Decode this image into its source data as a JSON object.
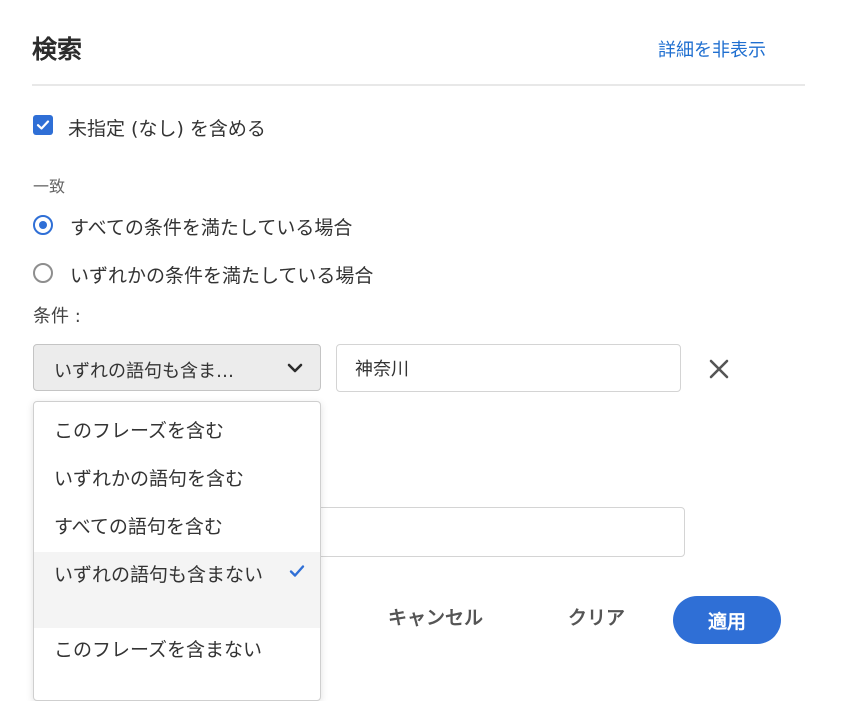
{
  "header": {
    "title": "検索",
    "toggle_details": "詳細を非表示"
  },
  "include_unspecified": {
    "label": "未指定 (なし) を含める",
    "checked": true
  },
  "match": {
    "label": "一致",
    "options": [
      {
        "label": "すべての条件を満たしている場合",
        "selected": true
      },
      {
        "label": "いずれかの条件を満たしている場合",
        "selected": false
      }
    ]
  },
  "conditions": {
    "label": "条件 :",
    "operator_selected": "いずれの語句も含ま…",
    "value": "神奈川"
  },
  "dropdown": {
    "options": [
      {
        "label": "このフレーズを含む",
        "selected": false
      },
      {
        "label": "いずれかの語句を含む",
        "selected": false
      },
      {
        "label": "すべての語句を含む",
        "selected": false
      },
      {
        "label": "いずれの語句も含まない",
        "selected": true
      },
      {
        "label": "このフレーズを含まない",
        "selected": false
      }
    ]
  },
  "actions": {
    "cancel": "キャンセル",
    "clear": "クリア",
    "apply": "適用"
  },
  "colors": {
    "accent": "#2f6fd6",
    "link": "#1f6fd0"
  }
}
